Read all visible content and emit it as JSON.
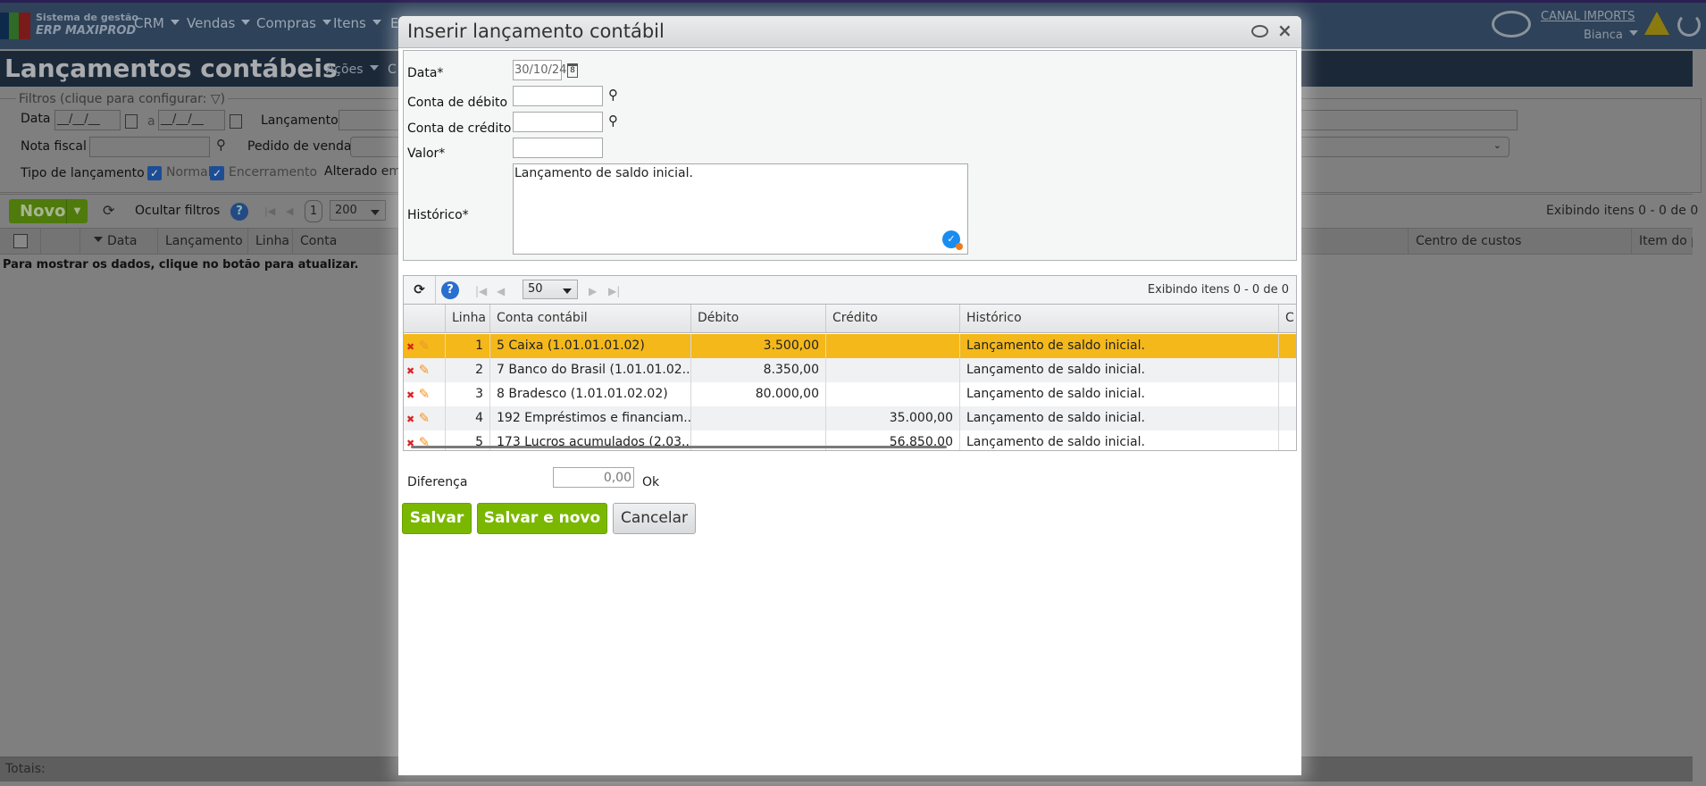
{
  "nav": {
    "logo_line1": "Sistema de gestão",
    "logo_line2": "ERP MAXIPROD",
    "menu": [
      "CRM",
      "Vendas",
      "Compras",
      "Itens",
      "E"
    ],
    "company": "CANAL IMPORTS",
    "user": "Bianca"
  },
  "page": {
    "title": "Lançamentos contábeis",
    "actions": "Ações",
    "actions2": "C"
  },
  "filters": {
    "legend": "Filtros (clique para configurar:",
    "legend_end": ")",
    "data_label": "Data",
    "date_placeholder": "__/__/__",
    "a": "a",
    "lancamento_label": "Lançamento",
    "nota_label": "Nota fiscal",
    "pedido_label": "Pedido de venda",
    "tipo_label": "Tipo de lançamento",
    "normal": "Normal",
    "encerramento": "Encerramento",
    "alterado": "Alterado em"
  },
  "toolbar": {
    "novo": "Novo",
    "ocultar": "Ocultar filtros",
    "page": "1",
    "per_page": "200",
    "status": "Exibindo itens 0 - 0 de 0"
  },
  "grid": {
    "columns": [
      "Data",
      "Lançamento",
      "Linha",
      "Conta",
      "Centro de custos",
      "Item do pe"
    ],
    "empty": "Para mostrar os dados, clique no botão para atualizar.",
    "totals": "Totais:"
  },
  "modal": {
    "title": "Inserir lançamento contábil",
    "form": {
      "data_label": "Data*",
      "data_value": "30/10/24",
      "debito_label": "Conta de débito",
      "credito_label": "Conta de crédito",
      "valor_label": "Valor*",
      "historico_label": "Histórico*",
      "historico_value": "Lançamento de saldo inicial.",
      "debito_value": "",
      "credito_value": "",
      "valor_value": ""
    },
    "grid": {
      "per_page": "50",
      "status": "Exibindo itens 0 - 0 de 0",
      "columns": [
        "Linha",
        "Conta contábil",
        "Débito",
        "Crédito",
        "Histórico",
        "C"
      ],
      "rows": [
        {
          "linha": "1",
          "conta": "5 Caixa (1.01.01.01.02)",
          "debito": "3.500,00",
          "credito": "",
          "historico": "Lançamento de saldo inicial."
        },
        {
          "linha": "2",
          "conta": "7 Banco do Brasil (1.01.01.02...",
          "debito": "8.350,00",
          "credito": "",
          "historico": "Lançamento de saldo inicial."
        },
        {
          "linha": "3",
          "conta": "8 Bradesco (1.01.01.02.02)",
          "debito": "80.000,00",
          "credito": "",
          "historico": "Lançamento de saldo inicial."
        },
        {
          "linha": "4",
          "conta": "192 Empréstimos e financiam...",
          "debito": "",
          "credito": "35.000,00",
          "historico": "Lançamento de saldo inicial."
        },
        {
          "linha": "5",
          "conta": "173 Lucros acumulados (2.03...",
          "debito": "",
          "credito": "56.850,00",
          "historico": "Lançamento de saldo inicial."
        }
      ]
    },
    "diferenca_label": "Diferença",
    "diferenca_value": "0,00",
    "diferenca_status": "Ok",
    "buttons": {
      "salvar": "Salvar",
      "salvar_novo": "Salvar e novo",
      "cancelar": "Cancelar"
    }
  },
  "colors": {
    "selected_row": "#f4b81a",
    "accent_green": "#7ab800",
    "nav": "#2e4259"
  }
}
